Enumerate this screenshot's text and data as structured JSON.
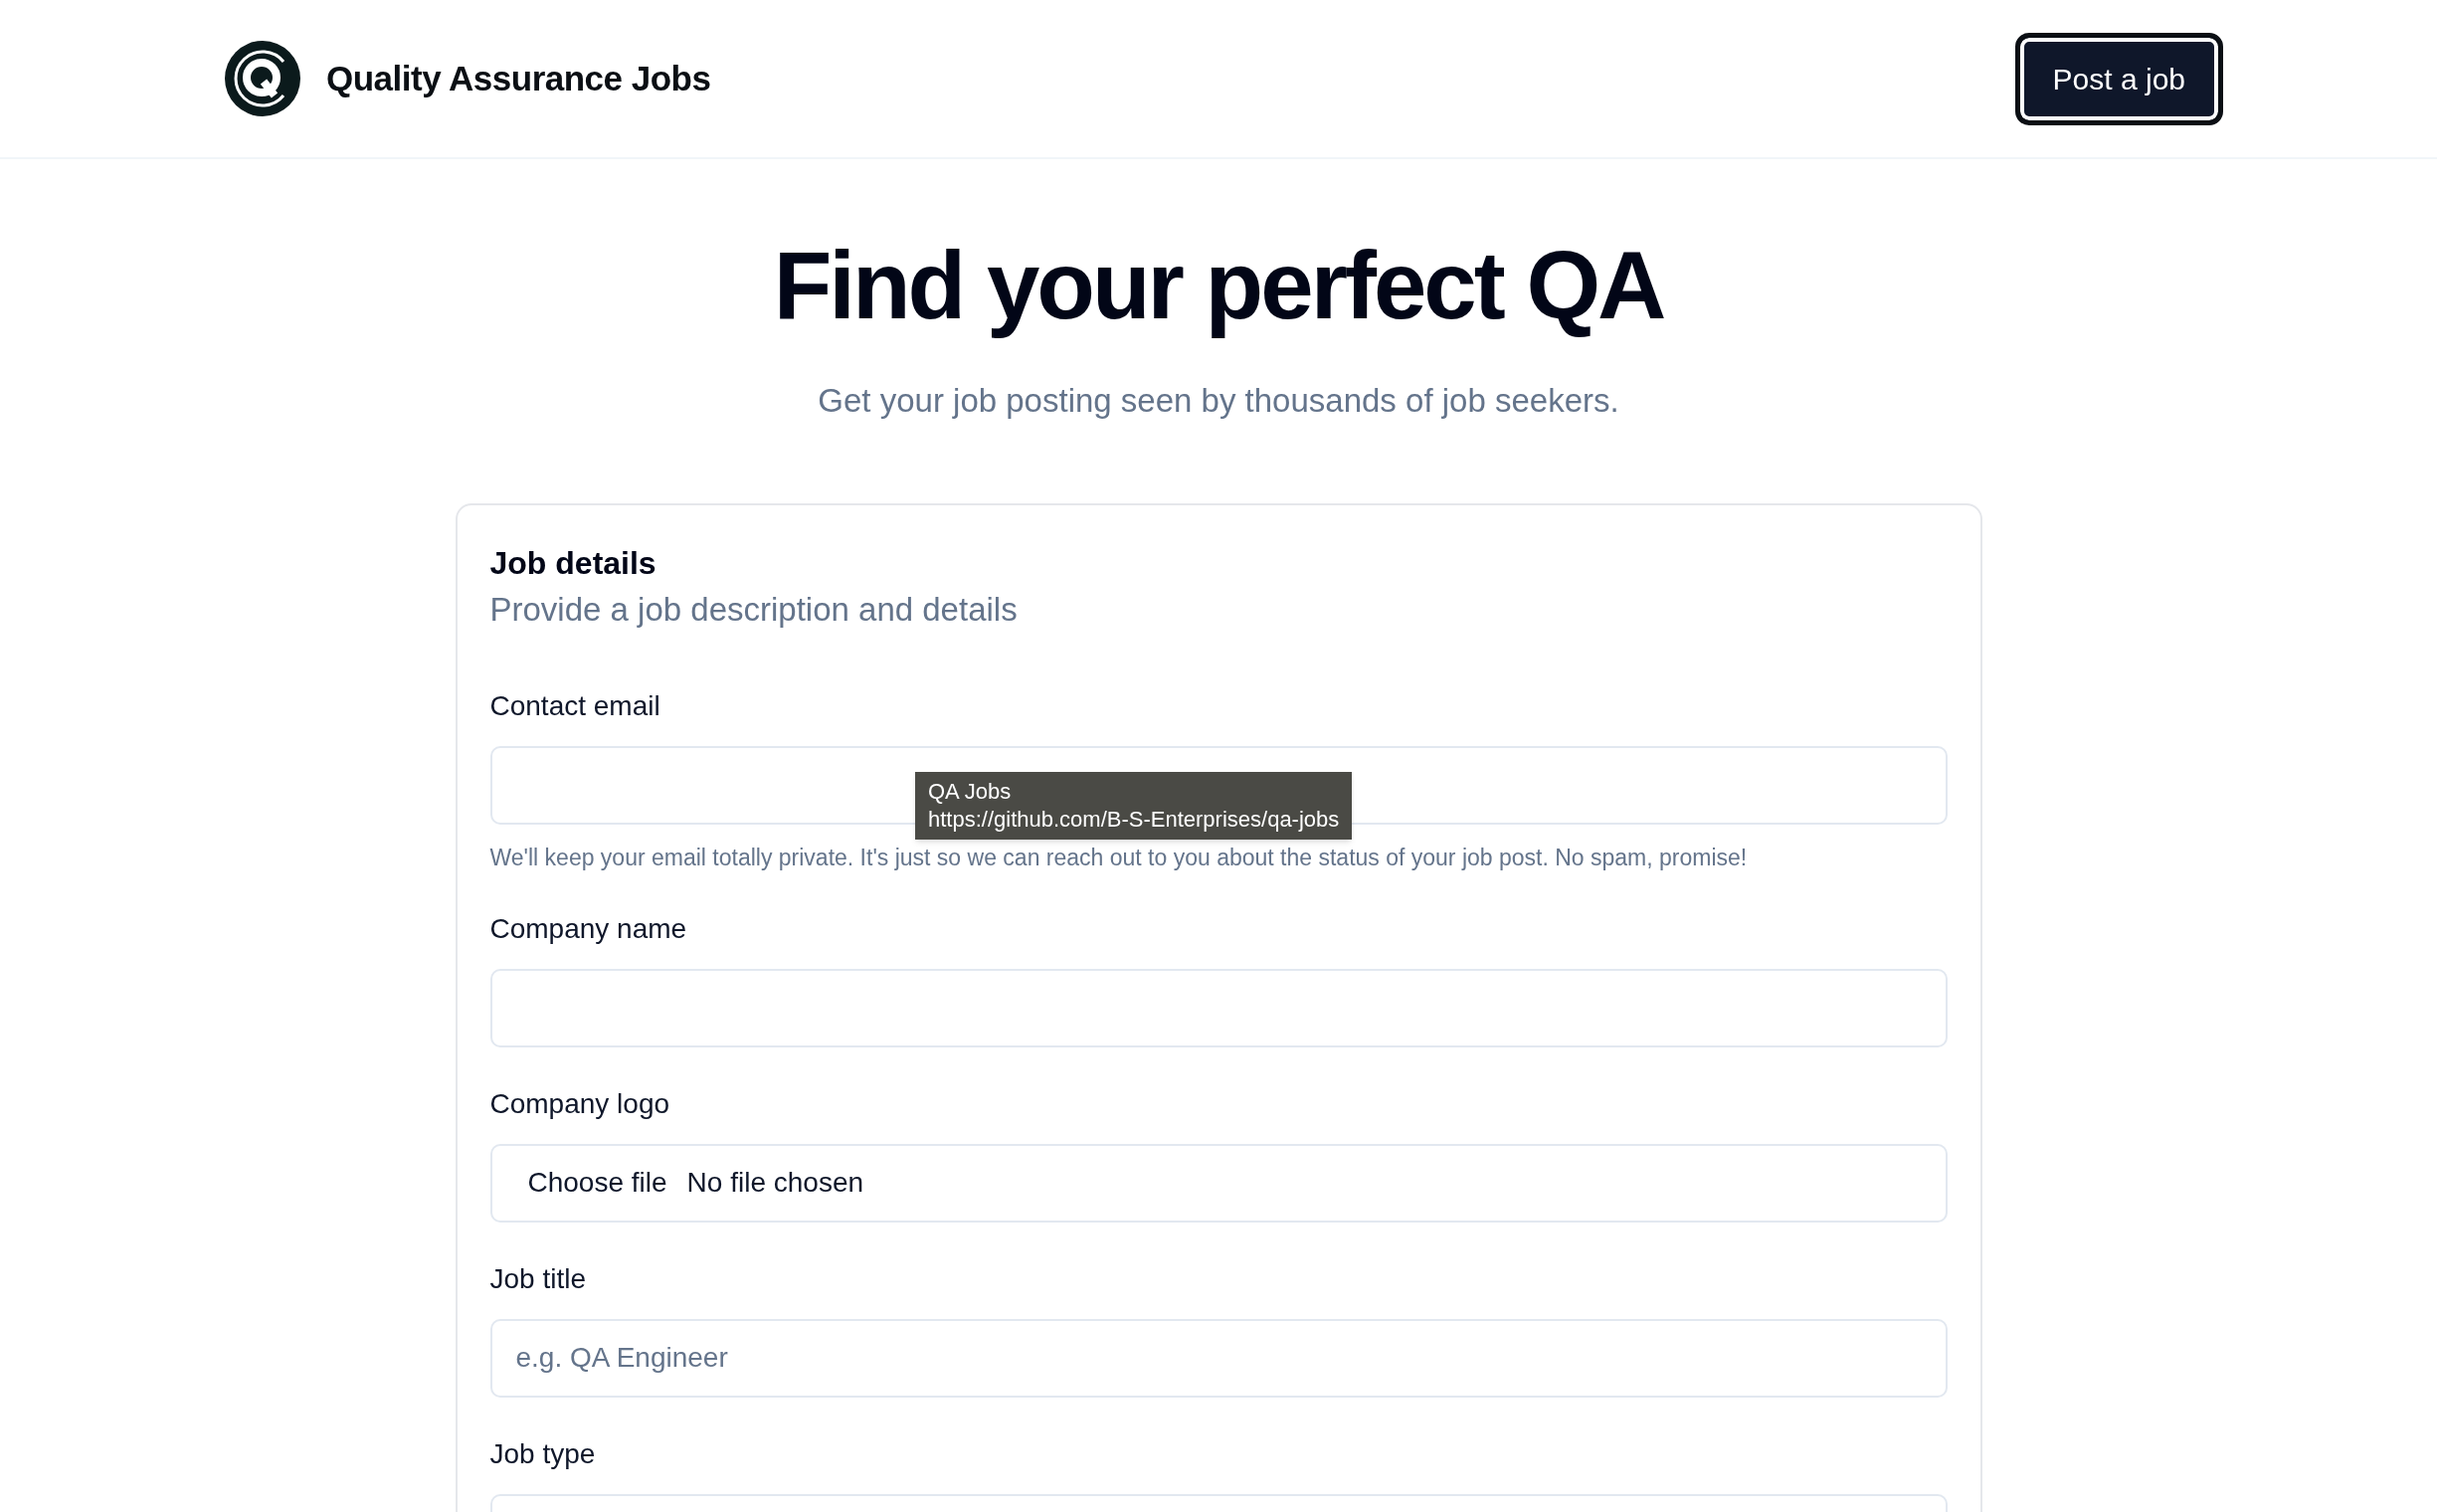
{
  "header": {
    "site_title": "Quality Assurance Jobs",
    "post_button": "Post a job"
  },
  "hero": {
    "title": "Find your perfect QA",
    "subtitle": "Get your job posting seen by thousands of job seekers."
  },
  "form": {
    "title": "Job details",
    "description": "Provide a job description and details",
    "fields": [
      {
        "kind": "text",
        "label": "Contact email",
        "help": "We'll keep your email totally private. It's just so we can reach out to you about the status of your job post. No spam, promise!"
      },
      {
        "kind": "text",
        "label": "Company name"
      },
      {
        "kind": "file",
        "label": "Company logo",
        "button": "Choose file",
        "status": "No file chosen"
      },
      {
        "kind": "text",
        "label": "Job title",
        "placeholder": "e.g. QA Engineer"
      },
      {
        "kind": "text",
        "label": "Job type"
      }
    ]
  },
  "tooltip": {
    "title": "QA Jobs",
    "url": "https://github.com/B-S-Enterprises/qa-jobs"
  }
}
